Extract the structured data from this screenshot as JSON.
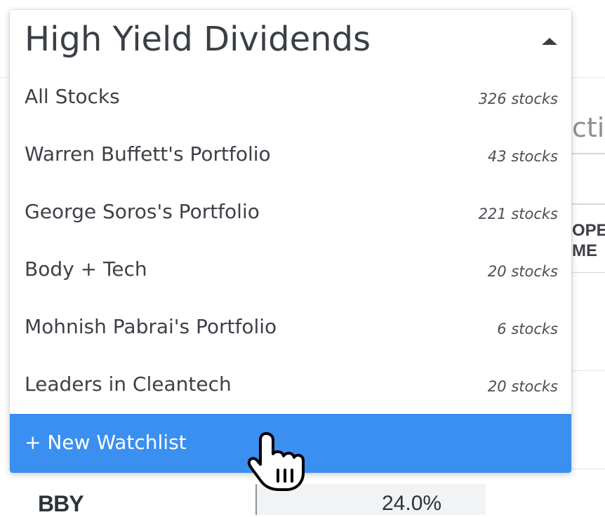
{
  "background": {
    "section_fragment": "ctio",
    "column_header_line1": "OPE",
    "column_header_line2": "ME",
    "first_row": {
      "ticker": "BBY",
      "value": "24.0%"
    }
  },
  "dropdown": {
    "selected": "High Yield Dividends",
    "items": [
      {
        "name": "All Stocks",
        "count": "326 stocks"
      },
      {
        "name": "Warren Buffett's Portfolio",
        "count": "43 stocks"
      },
      {
        "name": "George Soros's Portfolio",
        "count": "221 stocks"
      },
      {
        "name": "Body + Tech",
        "count": "20 stocks"
      },
      {
        "name": "Mohnish Pabrai's Portfolio",
        "count": "6 stocks"
      },
      {
        "name": "Leaders in Cleantech",
        "count": "20 stocks"
      }
    ],
    "new_watchlist_label": "+ New Watchlist"
  },
  "colors": {
    "accent": "#3b8ff0",
    "text": "#3d4147"
  },
  "icons": {
    "caret": "caret-up-icon",
    "cursor": "hand-pointer-cursor-icon"
  }
}
